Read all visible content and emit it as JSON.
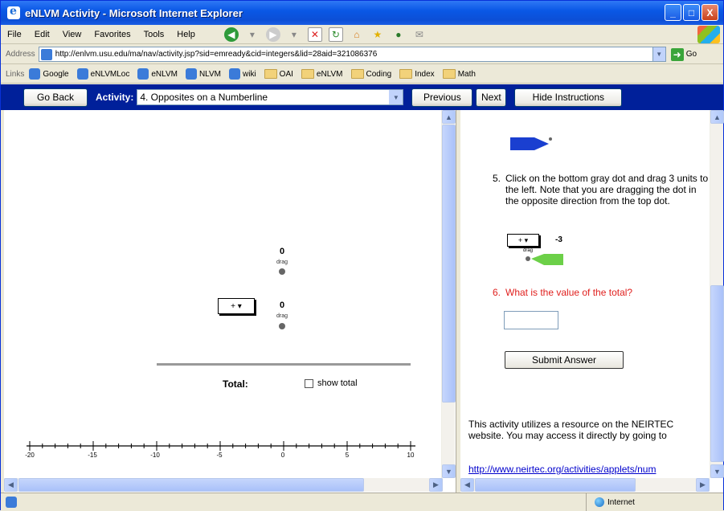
{
  "window": {
    "title": "eNLVM Activity - Microsoft Internet Explorer",
    "buttons": {
      "minimize": "_",
      "maximize": "□",
      "close": "X"
    }
  },
  "menu": {
    "items": [
      "File",
      "Edit",
      "View",
      "Favorites",
      "Tools",
      "Help"
    ]
  },
  "address": {
    "label": "Address",
    "url": "http://enlvm.usu.edu/ma/nav/activity.jsp?sid=emready&cid=integers&lid=28aid=321086376",
    "go_label": "Go"
  },
  "links": {
    "label": "Links",
    "items": [
      "Google",
      "eNLVMLoc",
      "eNLVM",
      "NLVM",
      "wiki",
      "OAI",
      "eNLVM",
      "Coding",
      "Index",
      "Math"
    ]
  },
  "activity_toolbar": {
    "go_back_label": "Go Back",
    "activity_label": "Activity:",
    "activity_value": "4. Opposites on a Numberline",
    "previous_label": "Previous",
    "next_label": "Next",
    "hide_label": "Hide Instructions"
  },
  "applet": {
    "top_value": "0",
    "top_drag": "drag",
    "bottom_value": "0",
    "bottom_drag": "drag",
    "sign_select": "+ ▾",
    "total_label": "Total:",
    "show_total_label": "show total",
    "number_line_ticks": [
      "-20",
      "-15",
      "-10",
      "-5",
      "0",
      "5",
      "10"
    ]
  },
  "instructions": {
    "step5_number": "5.",
    "step5_text": "Click on the bottom gray dot and drag 3 units to the left. Note that you are dragging the dot in the opposite direction from the top dot.",
    "step5_img_sign": "+ ▾",
    "step5_img_value": "-3",
    "step5_img_drag": "drag",
    "step6_number": "6.",
    "step6_text": "What is the value of the total?",
    "answer_value": "",
    "submit_label": "Submit Answer",
    "footer_text": "This activity utilizes a resource on the NEIRTEC website. You may access it directly by going to",
    "footer_link": "http://www.neirtec.org/activities/applets/num"
  },
  "status": {
    "left_text": "",
    "zone_text": "Internet"
  },
  "colors": {
    "activity_bar": "#00209a",
    "question_red": "#e0201e",
    "arrow_blue": "#1a3fd0",
    "arrow_green": "#6cd048"
  }
}
